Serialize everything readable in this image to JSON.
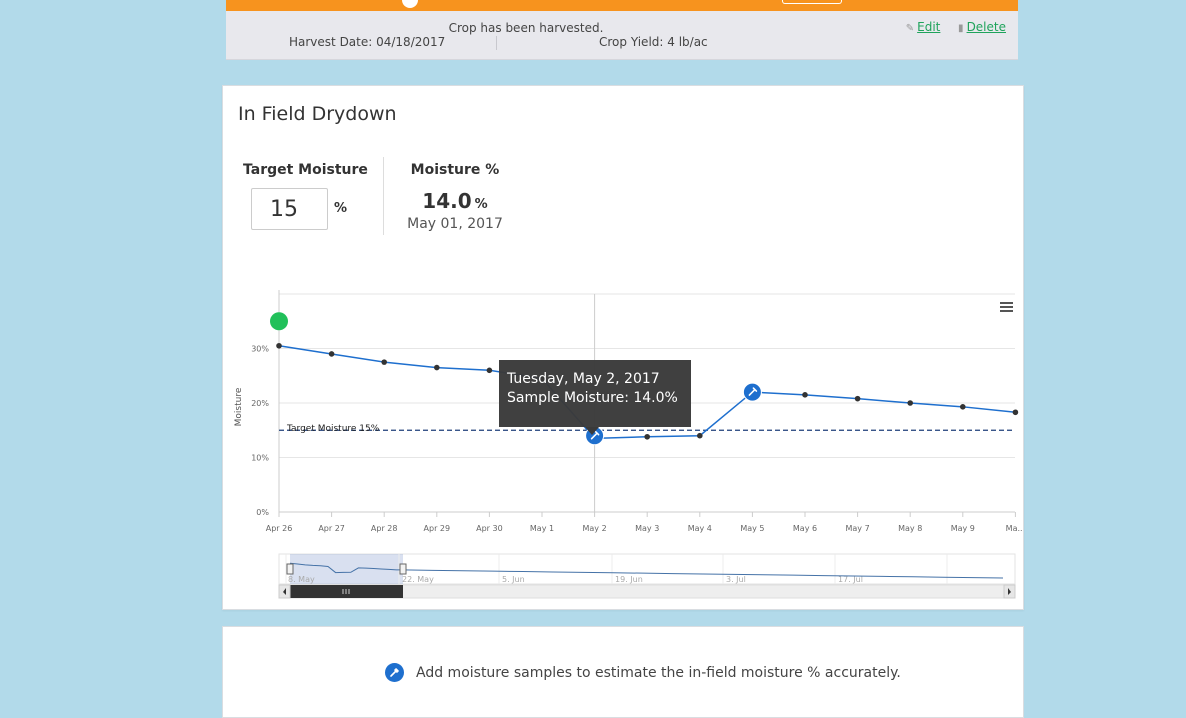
{
  "harvest": {
    "message": "Crop has been harvested.",
    "harvest_date": "Harvest Date: 04/18/2017",
    "crop_yield": "Crop Yield: 4 lb/ac",
    "edit_label": "Edit",
    "delete_label": "Delete"
  },
  "drydown": {
    "title": "In Field Drydown",
    "target_moisture_label": "Target Moisture",
    "target_moisture_value": "15",
    "target_moisture_unit": "%",
    "moisture_label": "Moisture %",
    "moisture_value": "14.0",
    "moisture_unit": "%",
    "moisture_date": "May 01, 2017"
  },
  "chart_data": {
    "type": "line",
    "title": "",
    "xlabel": "",
    "ylabel": "Moisture",
    "categories": [
      "Apr 26",
      "Apr 27",
      "Apr 28",
      "Apr 29",
      "Apr 30",
      "May 1",
      "May 2",
      "May 3",
      "May 4",
      "May 5",
      "May 6",
      "May 7",
      "May 8",
      "May 9",
      "Ma..."
    ],
    "yticks": [
      "0%",
      "10%",
      "20%",
      "30%"
    ],
    "ylim": [
      0,
      40
    ],
    "series": [
      {
        "values": [
          30.5,
          29.0,
          27.5,
          26.5,
          26.0,
          24.5,
          13.5,
          13.8,
          14.0,
          22.0,
          21.5,
          20.8,
          20.0,
          19.3,
          18.3
        ],
        "color": "#1e6fce"
      }
    ],
    "sample_points": [
      {
        "x": "May 2",
        "y": 14.0
      },
      {
        "x": "May 5",
        "y": 22.0
      }
    ],
    "harvest_marker": {
      "x": "Apr 26",
      "y": 35.0,
      "color": "#21c05a"
    },
    "target_line": {
      "value": 15,
      "label": "Target Moisture 15%"
    },
    "tooltip": {
      "line1": "Tuesday, May 2, 2017",
      "line2": "Sample Moisture: 14.0%"
    },
    "navigator_labels": [
      "8. May",
      "22. May",
      "5. Jun",
      "19. Jun",
      "3. Jul",
      "17. Jul"
    ],
    "grid": true
  },
  "info": {
    "text": "Add moisture samples to estimate the in-field moisture % accurately."
  },
  "colors": {
    "page_background": "#b2daea",
    "accent_orange": "#f7931e",
    "line_blue": "#1e6fce",
    "link_green": "#1fa35b"
  },
  "icons": {
    "edit": "pencil-icon",
    "delete": "trash-icon",
    "menu": "hamburger-menu-icon",
    "sample": "dropper-icon"
  }
}
